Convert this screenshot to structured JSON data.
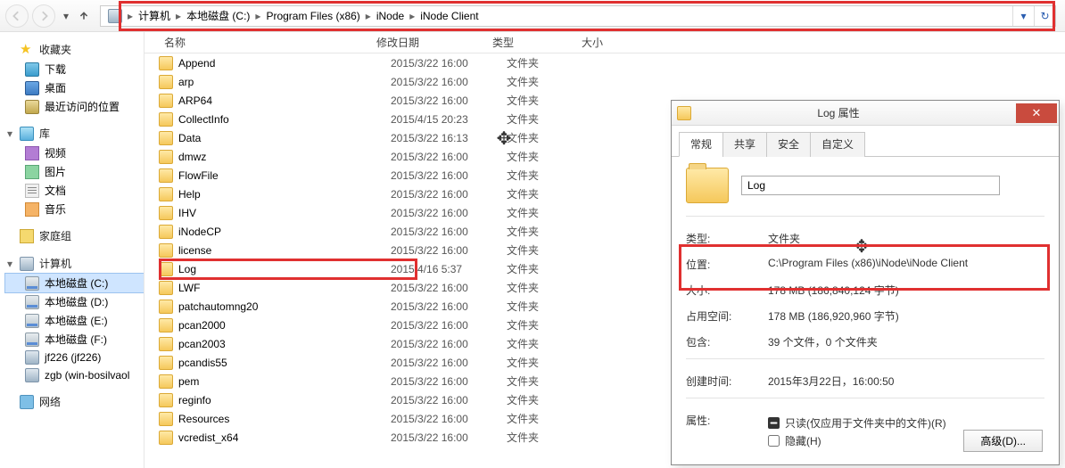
{
  "toolbar": {
    "breadcrumbs": [
      "计算机",
      "本地磁盘 (C:)",
      "Program Files (x86)",
      "iNode",
      "iNode Client"
    ]
  },
  "sidebar": {
    "favorites": {
      "label": "收藏夹",
      "items": [
        "下载",
        "桌面",
        "最近访问的位置"
      ]
    },
    "libraries": {
      "label": "库",
      "items": [
        "视频",
        "图片",
        "文档",
        "音乐"
      ]
    },
    "homegroup": {
      "label": "家庭组"
    },
    "computer": {
      "label": "计算机",
      "items": [
        "本地磁盘 (C:)",
        "本地磁盘 (D:)",
        "本地磁盘 (E:)",
        "本地磁盘 (F:)",
        "jf226 (jf226)",
        "zgb (win-bosilvaol"
      ]
    },
    "network": {
      "label": "网络"
    }
  },
  "columns": {
    "name": "名称",
    "date": "修改日期",
    "type": "类型",
    "size": "大小"
  },
  "files": [
    {
      "name": "Append",
      "date": "2015/3/22 16:00",
      "type": "文件夹"
    },
    {
      "name": "arp",
      "date": "2015/3/22 16:00",
      "type": "文件夹"
    },
    {
      "name": "ARP64",
      "date": "2015/3/22 16:00",
      "type": "文件夹"
    },
    {
      "name": "CollectInfo",
      "date": "2015/4/15 20:23",
      "type": "文件夹"
    },
    {
      "name": "Data",
      "date": "2015/3/22 16:13",
      "type": "文件夹",
      "cursor": true
    },
    {
      "name": "dmwz",
      "date": "2015/3/22 16:00",
      "type": "文件夹"
    },
    {
      "name": "FlowFile",
      "date": "2015/3/22 16:00",
      "type": "文件夹"
    },
    {
      "name": "Help",
      "date": "2015/3/22 16:00",
      "type": "文件夹"
    },
    {
      "name": "IHV",
      "date": "2015/3/22 16:00",
      "type": "文件夹"
    },
    {
      "name": "iNodeCP",
      "date": "2015/3/22 16:00",
      "type": "文件夹"
    },
    {
      "name": "license",
      "date": "2015/3/22 16:00",
      "type": "文件夹"
    },
    {
      "name": "Log",
      "date": "2015/4/16 5:37",
      "type": "文件夹",
      "highlight": true
    },
    {
      "name": "LWF",
      "date": "2015/3/22 16:00",
      "type": "文件夹"
    },
    {
      "name": "patchautomng20",
      "date": "2015/3/22 16:00",
      "type": "文件夹"
    },
    {
      "name": "pcan2000",
      "date": "2015/3/22 16:00",
      "type": "文件夹"
    },
    {
      "name": "pcan2003",
      "date": "2015/3/22 16:00",
      "type": "文件夹"
    },
    {
      "name": "pcandis55",
      "date": "2015/3/22 16:00",
      "type": "文件夹"
    },
    {
      "name": "pem",
      "date": "2015/3/22 16:00",
      "type": "文件夹"
    },
    {
      "name": "reginfo",
      "date": "2015/3/22 16:00",
      "type": "文件夹"
    },
    {
      "name": "Resources",
      "date": "2015/3/22 16:00",
      "type": "文件夹"
    },
    {
      "name": "vcredist_x64",
      "date": "2015/3/22 16:00",
      "type": "文件夹"
    }
  ],
  "dialog": {
    "title": "Log 属性",
    "tabs": [
      "常规",
      "共享",
      "安全",
      "自定义"
    ],
    "name_value": "Log",
    "rows": {
      "type_label": "类型:",
      "type_val": "文件夹",
      "loc_label": "位置:",
      "loc_val": "C:\\Program Files (x86)\\iNode\\iNode Client",
      "size_label": "大小:",
      "size_val": "178 MB (186,840,124 字节)",
      "disk_label": "占用空间:",
      "disk_val": "178 MB (186,920,960 字节)",
      "contains_label": "包含:",
      "contains_val": "39 个文件，0 个文件夹",
      "created_label": "创建时间:",
      "created_val": "2015年3月22日，16:00:50",
      "attr_label": "属性:",
      "readonly_label": "只读(仅应用于文件夹中的文件)(R)",
      "hidden_label": "隐藏(H)",
      "advanced": "高级(D)..."
    }
  }
}
